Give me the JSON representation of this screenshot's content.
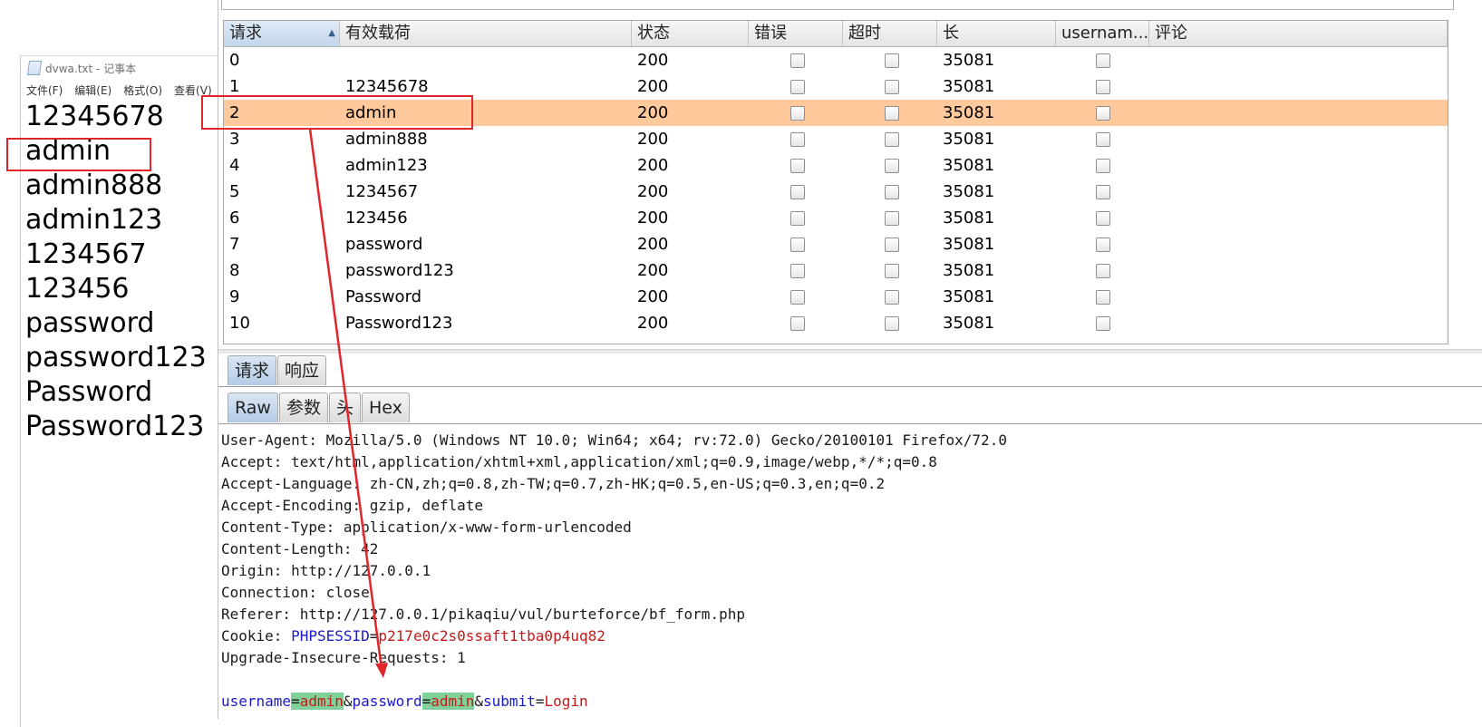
{
  "notepad": {
    "title": "dvwa.txt - 记事本",
    "menu": [
      "文件(F)",
      "编辑(E)",
      "格式(O)",
      "查看(V)"
    ],
    "lines": [
      "12345678",
      "admin",
      "admin888",
      "admin123",
      "1234567",
      "123456",
      "password",
      "password123",
      "Password",
      "Password123"
    ]
  },
  "results_table": {
    "headers": [
      "请求",
      "有效载荷",
      "状态",
      "错误",
      "超时",
      "长",
      "usernam...",
      "评论"
    ],
    "selected_row": 2,
    "rows": [
      {
        "request": "0",
        "payload": "",
        "status": "200",
        "length": "35081"
      },
      {
        "request": "1",
        "payload": "12345678",
        "status": "200",
        "length": "35081"
      },
      {
        "request": "2",
        "payload": "admin",
        "status": "200",
        "length": "35081"
      },
      {
        "request": "3",
        "payload": "admin888",
        "status": "200",
        "length": "35081"
      },
      {
        "request": "4",
        "payload": "admin123",
        "status": "200",
        "length": "35081"
      },
      {
        "request": "5",
        "payload": "1234567",
        "status": "200",
        "length": "35081"
      },
      {
        "request": "6",
        "payload": "123456",
        "status": "200",
        "length": "35081"
      },
      {
        "request": "7",
        "payload": "password",
        "status": "200",
        "length": "35081"
      },
      {
        "request": "8",
        "payload": "password123",
        "status": "200",
        "length": "35081"
      },
      {
        "request": "9",
        "payload": "Password",
        "status": "200",
        "length": "35081"
      },
      {
        "request": "10",
        "payload": "Password123",
        "status": "200",
        "length": "35081"
      }
    ]
  },
  "tabs_main": [
    "请求",
    "响应"
  ],
  "tabs_view": [
    "Raw",
    "参数",
    "头",
    "Hex"
  ],
  "request_raw": {
    "lines": [
      "User-Agent: Mozilla/5.0 (Windows NT 10.0; Win64; x64; rv:72.0) Gecko/20100101 Firefox/72.0",
      "Accept: text/html,application/xhtml+xml,application/xml;q=0.9,image/webp,*/*;q=0.8",
      "Accept-Language: zh-CN,zh;q=0.8,zh-TW;q=0.7,zh-HK;q=0.5,en-US;q=0.3,en;q=0.2",
      "Accept-Encoding: gzip, deflate",
      "Content-Type: application/x-www-form-urlencoded",
      "Content-Length: 42",
      "Origin: http://127.0.0.1",
      "Connection: close",
      "Referer: http://127.0.0.1/pikaqiu/vul/burteforce/bf_form.php"
    ],
    "cookie_label": "Cookie: ",
    "cookie_name": "PHPSESSID",
    "cookie_eq": "=",
    "cookie_value": "p217e0c2s0ssaft1tba0p4uq82",
    "upgrade_line": "Upgrade-Insecure-Requests: 1",
    "body": {
      "p1_key": "username",
      "p1_eq": "=",
      "p1_val": "admin",
      "amp1": "&",
      "p2_key": "password",
      "p2_eq": "=",
      "p2_val": "admin",
      "amp2": "&",
      "p3_key": "submit",
      "p3_eq": "=",
      "p3_val": "Login"
    }
  },
  "colors": {
    "selected_row": "#ffc99b",
    "annotation_red": "#e0262a",
    "param_highlight": "#7fd199",
    "key_blue": "#1a1ac8",
    "value_red": "#c41a1a"
  }
}
